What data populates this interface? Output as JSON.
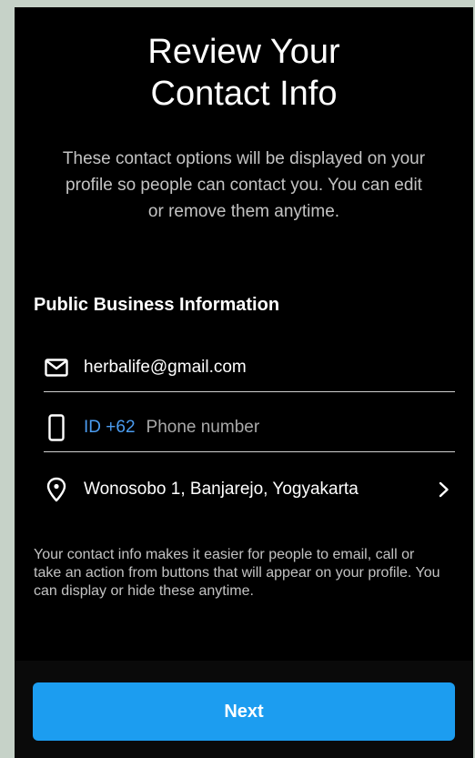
{
  "header": {
    "title_line1": "Review Your",
    "title_line2": "Contact Info",
    "subtitle": "These contact options will be displayed on your profile so people can contact you. You can edit or remove them anytime."
  },
  "section": {
    "heading": "Public Business Information"
  },
  "contact": {
    "email": {
      "icon": "mail-icon",
      "value": "herbalife@gmail.com"
    },
    "phone": {
      "icon": "phone-icon",
      "country_code": "ID +62",
      "placeholder": "Phone number"
    },
    "address": {
      "icon": "location-pin-icon",
      "value": "Wonosobo 1, Banjarejo, Yogyakarta",
      "action_icon": "chevron-right-icon"
    }
  },
  "info_text": "Your contact info makes it easier for people to email, call or take an action from buttons that will appear on your profile. You can display or hide these anytime.",
  "footer": {
    "next_label": "Next"
  },
  "colors": {
    "background": "#000000",
    "accent": "#1c9df0",
    "country_code": "#4b9cf0",
    "frame": "#c6d2c8"
  }
}
